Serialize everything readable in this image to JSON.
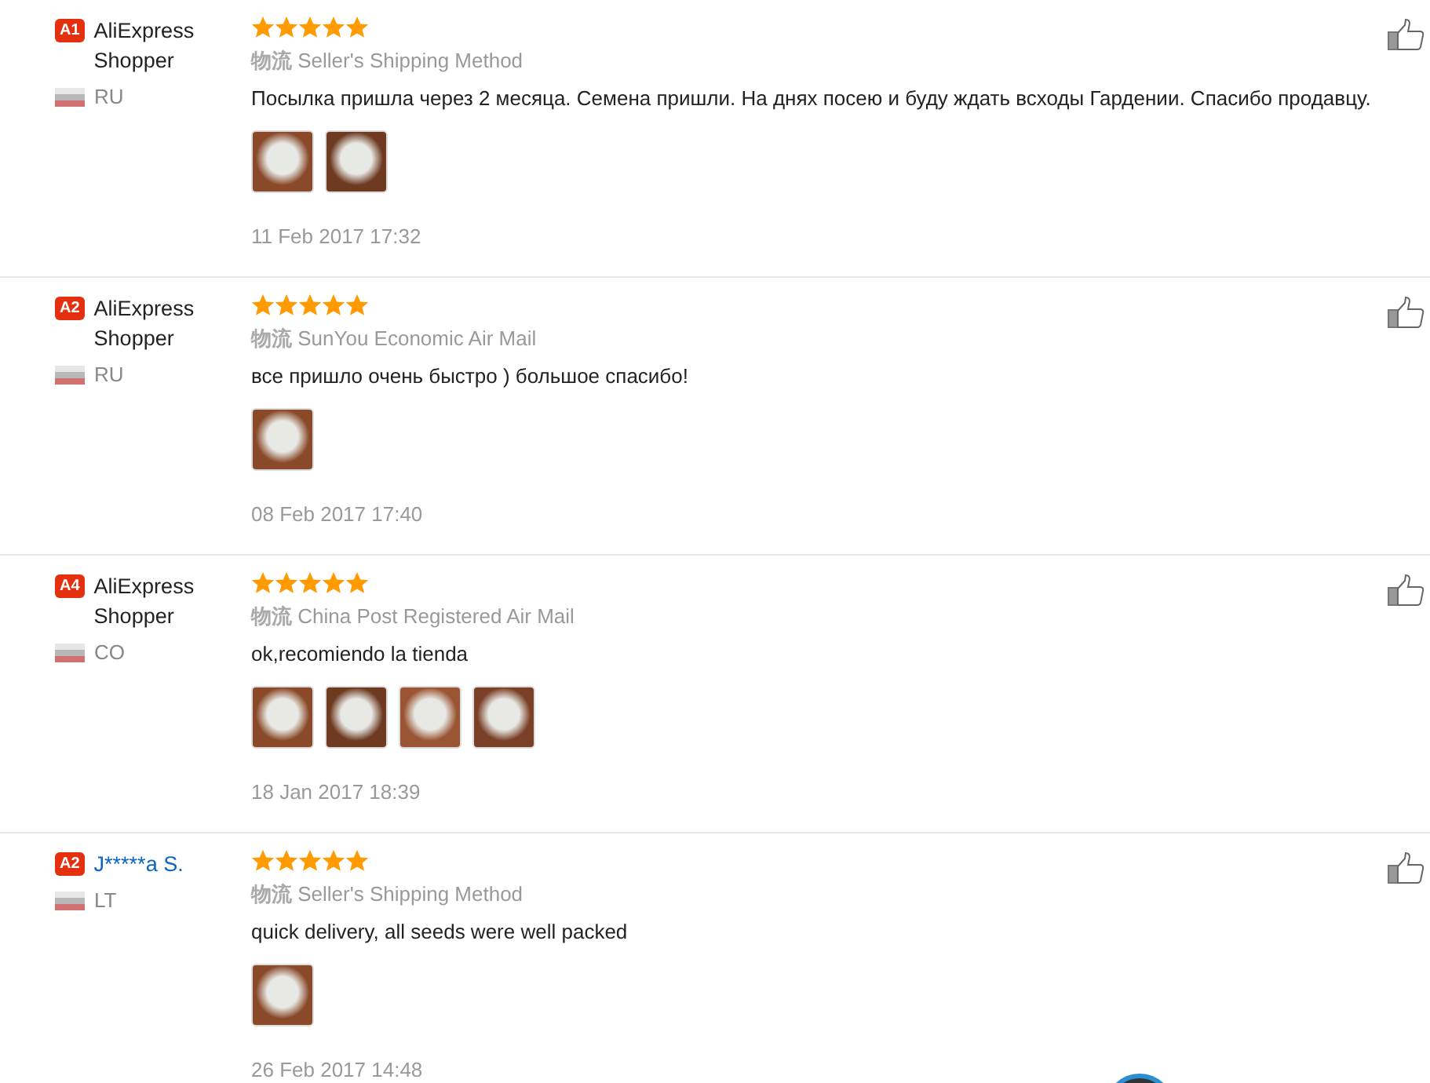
{
  "reviews": [
    {
      "badge": "A1",
      "name": "AliExpress Shopper",
      "kind": "plain",
      "country": "RU",
      "stars": 5,
      "shipping_label": "物流",
      "shipping_method": "Seller's Shipping Method",
      "text": "Посылка пришла через 2 месяца. Семена пришли. На днях посею и буду ждать всходы Гардении. Спасибо продавцу.",
      "photos": [
        {
          "kind": "photo"
        },
        {
          "kind": "photo"
        }
      ],
      "date": "11 Feb 2017 17:32"
    },
    {
      "badge": "A2",
      "name": "AliExpress Shopper",
      "kind": "plain",
      "country": "RU",
      "stars": 5,
      "shipping_label": "物流",
      "shipping_method": "SunYou Economic Air Mail",
      "text": "все пришло очень быстро ) большое спасибо!",
      "photos": [
        {
          "kind": "photo"
        }
      ],
      "date": "08 Feb 2017 17:40"
    },
    {
      "badge": "A4",
      "name": "AliExpress Shopper",
      "kind": "plain",
      "country": "CO",
      "stars": 5,
      "shipping_label": "物流",
      "shipping_method": "China Post Registered Air Mail",
      "text": "ok,recomiendo la tienda",
      "photos": [
        {
          "kind": "photo"
        },
        {
          "kind": "photo"
        },
        {
          "kind": "photo"
        },
        {
          "kind": "photo"
        }
      ],
      "date": "18 Jan 2017 18:39"
    },
    {
      "badge": "A2",
      "name": "J*****a S.",
      "kind": "link",
      "country": "LT",
      "stars": 5,
      "shipping_label": "物流",
      "shipping_method": "Seller's Shipping Method",
      "text": "quick delivery, all seeds were well packed",
      "photos": [
        {
          "kind": "photo"
        }
      ],
      "date": "26 Feb 2017 14:48"
    }
  ]
}
